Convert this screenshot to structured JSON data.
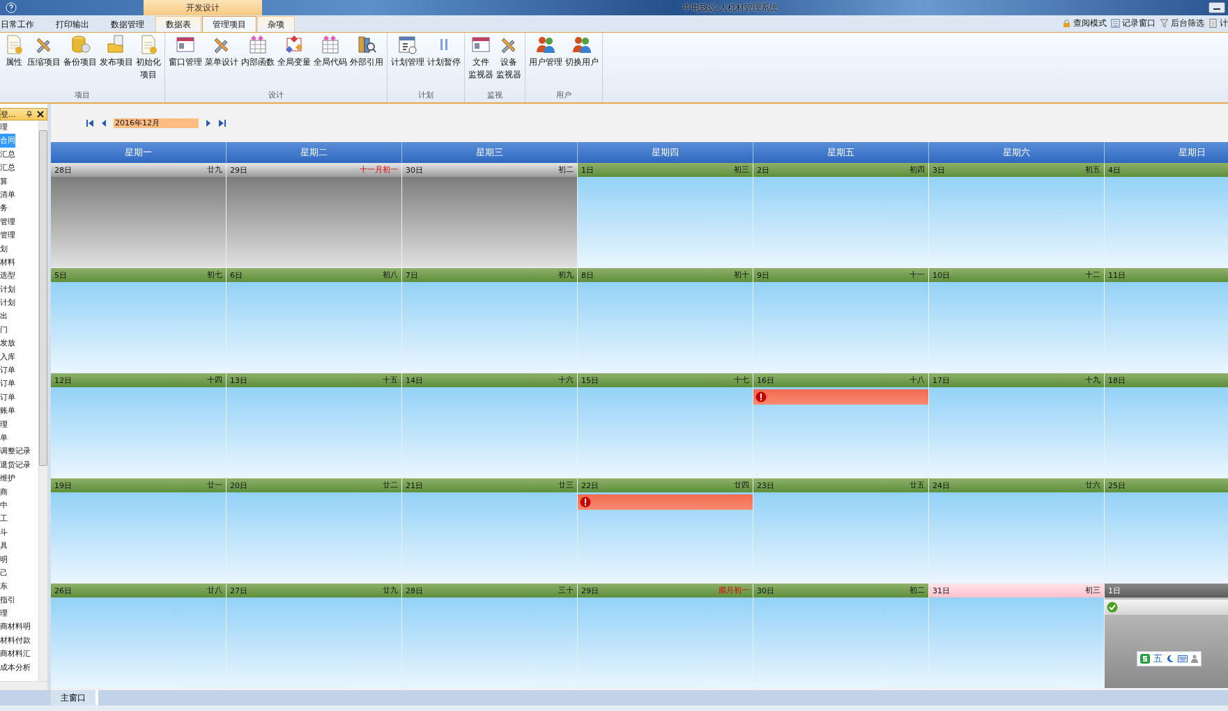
{
  "window": {
    "title": "中电致远-人机材管理系统",
    "context_tab": "开发设计"
  },
  "tabs": [
    {
      "label": "日常工作",
      "selected": false
    },
    {
      "label": "打印输出",
      "selected": false
    },
    {
      "label": "数据管理",
      "selected": false
    },
    {
      "label": "数据表",
      "selected": false
    },
    {
      "label": "管理项目",
      "selected": true
    },
    {
      "label": "杂项",
      "selected": false
    }
  ],
  "quick_tools": [
    {
      "label": "查阅模式"
    },
    {
      "label": "记录窗口"
    },
    {
      "label": "后台筛选"
    },
    {
      "label": "计"
    }
  ],
  "ribbon_groups": [
    {
      "label": "项目",
      "buttons": [
        [
          "属性"
        ],
        [
          "压缩项目"
        ],
        [
          "备份项目"
        ],
        [
          "发布项目"
        ],
        [
          "初始化",
          "项目"
        ]
      ]
    },
    {
      "label": "设计",
      "buttons": [
        [
          "窗口管理"
        ],
        [
          "菜单设计"
        ],
        [
          "内部函数"
        ],
        [
          "全局变量"
        ],
        [
          "全局代码"
        ],
        [
          "外部引用"
        ]
      ]
    },
    {
      "label": "计划",
      "buttons": [
        [
          "计划管理"
        ],
        [
          "计划暂停"
        ]
      ]
    },
    {
      "label": "监视",
      "buttons": [
        [
          "文件",
          "监视器"
        ],
        [
          "设备",
          "监视器"
        ]
      ]
    },
    {
      "label": "用户",
      "buttons": [
        [
          "用户管理"
        ],
        [
          "切换用户"
        ]
      ]
    }
  ],
  "sidebar": {
    "title": "登...",
    "items": [
      {
        "label": "理",
        "selected": false
      },
      {
        "label": "合同",
        "selected": true
      },
      {
        "label": "汇总",
        "selected": false
      },
      {
        "label": "汇总",
        "selected": false
      },
      {
        "label": "算",
        "selected": false
      },
      {
        "label": "清单",
        "selected": false
      },
      {
        "label": "务",
        "selected": false
      },
      {
        "label": "管理",
        "selected": false
      },
      {
        "label": "管理",
        "selected": false
      },
      {
        "label": "划",
        "selected": false
      },
      {
        "label": "材料",
        "selected": false
      },
      {
        "label": "选型",
        "selected": false
      },
      {
        "label": "计划",
        "selected": false
      },
      {
        "label": "计划",
        "selected": false
      },
      {
        "label": "出",
        "selected": false
      },
      {
        "label": "门",
        "selected": false
      },
      {
        "label": "发放",
        "selected": false
      },
      {
        "label": "入库",
        "selected": false
      },
      {
        "label": "订单",
        "selected": false
      },
      {
        "label": "订单",
        "selected": false
      },
      {
        "label": "订单",
        "selected": false
      },
      {
        "label": "账单",
        "selected": false
      },
      {
        "label": "理",
        "selected": false
      },
      {
        "label": "单",
        "selected": false
      },
      {
        "label": "调整记录",
        "selected": false
      },
      {
        "label": "退货记录",
        "selected": false
      },
      {
        "label": "维护",
        "selected": false
      },
      {
        "label": "商",
        "selected": false
      },
      {
        "label": "中",
        "selected": false
      },
      {
        "label": "工",
        "selected": false
      },
      {
        "label": "斗",
        "selected": false
      },
      {
        "label": "具",
        "selected": false
      },
      {
        "label": "明",
        "selected": false
      },
      {
        "label": "己",
        "selected": false
      },
      {
        "label": "东",
        "selected": false
      },
      {
        "label": "指引",
        "selected": false
      },
      {
        "label": "理",
        "selected": false
      },
      {
        "label": "商材料明",
        "selected": false
      },
      {
        "label": "材料付款",
        "selected": false
      },
      {
        "label": "商材料汇",
        "selected": false
      },
      {
        "label": "成本分析",
        "selected": false
      }
    ]
  },
  "calendar": {
    "month": "2016年12月",
    "weekdays": [
      "星期一",
      "星期二",
      "星期三",
      "星期四",
      "星期五",
      "星期六",
      "星期日"
    ],
    "weeks": [
      [
        {
          "day": "28日",
          "lunar": "廿九",
          "kind": "other"
        },
        {
          "day": "29日",
          "lunar": "十一月初一",
          "kind": "other",
          "festival": true
        },
        {
          "day": "30日",
          "lunar": "初二",
          "kind": "other"
        },
        {
          "day": "1日",
          "lunar": "初三",
          "kind": "current"
        },
        {
          "day": "2日",
          "lunar": "初四",
          "kind": "current"
        },
        {
          "day": "3日",
          "lunar": "初五",
          "kind": "current"
        },
        {
          "day": "4日",
          "kind": "current"
        }
      ],
      [
        {
          "day": "5日",
          "lunar": "初七",
          "kind": "current"
        },
        {
          "day": "6日",
          "lunar": "初八",
          "kind": "current"
        },
        {
          "day": "7日",
          "lunar": "初九",
          "kind": "current"
        },
        {
          "day": "8日",
          "lunar": "初十",
          "kind": "current"
        },
        {
          "day": "9日",
          "lunar": "十一",
          "kind": "current"
        },
        {
          "day": "10日",
          "lunar": "十二",
          "kind": "current"
        },
        {
          "day": "11日",
          "kind": "current"
        }
      ],
      [
        {
          "day": "12日",
          "lunar": "十四",
          "kind": "current"
        },
        {
          "day": "13日",
          "lunar": "十五",
          "kind": "current"
        },
        {
          "day": "14日",
          "lunar": "十六",
          "kind": "current"
        },
        {
          "day": "15日",
          "lunar": "十七",
          "kind": "current"
        },
        {
          "day": "16日",
          "lunar": "十八",
          "kind": "current",
          "events": [
            {
              "kind": "alert"
            }
          ]
        },
        {
          "day": "17日",
          "lunar": "十九",
          "kind": "current"
        },
        {
          "day": "18日",
          "kind": "current"
        }
      ],
      [
        {
          "day": "19日",
          "lunar": "廿一",
          "kind": "current"
        },
        {
          "day": "20日",
          "lunar": "廿二",
          "kind": "current"
        },
        {
          "day": "21日",
          "lunar": "廿三",
          "kind": "current"
        },
        {
          "day": "22日",
          "lunar": "廿四",
          "kind": "current",
          "events": [
            {
              "kind": "alert"
            }
          ]
        },
        {
          "day": "23日",
          "lunar": "廿五",
          "kind": "current"
        },
        {
          "day": "24日",
          "lunar": "廿六",
          "kind": "current"
        },
        {
          "day": "25日",
          "kind": "current"
        }
      ],
      [
        {
          "day": "26日",
          "lunar": "廿八",
          "kind": "current"
        },
        {
          "day": "27日",
          "lunar": "廿九",
          "kind": "current"
        },
        {
          "day": "28日",
          "lunar": "三十",
          "kind": "current"
        },
        {
          "day": "29日",
          "lunar": "腊月初一",
          "kind": "current",
          "festival": true
        },
        {
          "day": "30日",
          "lunar": "初二",
          "kind": "current"
        },
        {
          "day": "31日",
          "lunar": "初三",
          "kind": "today"
        },
        {
          "day": "1日",
          "kind": "other",
          "events": [
            {
              "kind": "done"
            }
          ]
        }
      ]
    ]
  },
  "ime_toolbar": {
    "label": "五"
  },
  "document_tabs": [
    {
      "label": "主窗口",
      "selected": true
    }
  ]
}
